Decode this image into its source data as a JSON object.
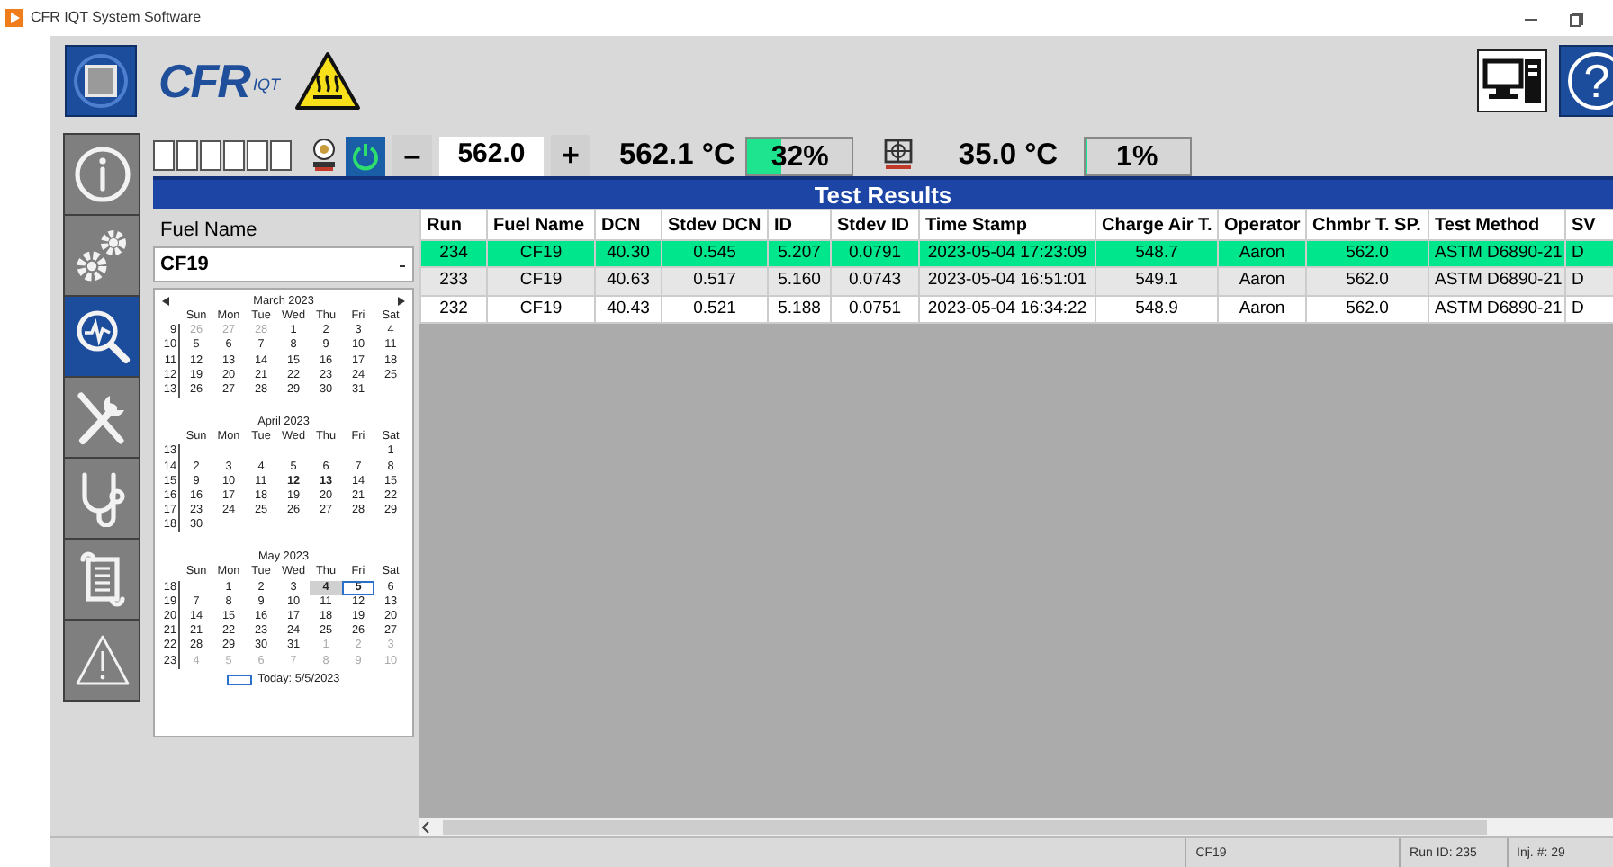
{
  "window": {
    "title": "CFR IQT System Software"
  },
  "header": {
    "logo": "CFR",
    "logo_sub": "IQT",
    "help": "?"
  },
  "sidebar": {
    "items": [
      {
        "kind": "info",
        "selected": false
      },
      {
        "kind": "settings",
        "selected": false
      },
      {
        "kind": "monitor",
        "selected": true
      },
      {
        "kind": "tools",
        "selected": false
      },
      {
        "kind": "diagnostics",
        "selected": false
      },
      {
        "kind": "log",
        "selected": false
      },
      {
        "kind": "alarms",
        "selected": false
      }
    ]
  },
  "toolbar": {
    "indicators": [
      {
        "on": false
      },
      {
        "on": false
      },
      {
        "on": false
      },
      {
        "on": false
      },
      {
        "on": false
      },
      {
        "on": false
      }
    ],
    "heater_power": {
      "on": true
    },
    "decrement": "–",
    "setpoint": "562.0",
    "increment": "+",
    "temperature": "562.1 °C",
    "heater_output": {
      "level": 0.32,
      "reading": "32%"
    },
    "chamber_temperature": "35.0 °C",
    "chamber_output": {
      "level": 0.01,
      "reading": "1%"
    }
  },
  "panel_title": "Test Results",
  "fuel": {
    "label": "Fuel Name",
    "value": "CF19"
  },
  "calendar": {
    "months": [
      {
        "title": "March 2023",
        "day_names": [
          "Sun",
          "Mon",
          "Tue",
          "Wed",
          "Thu",
          "Fri",
          "Sat"
        ],
        "weeks": [
          {
            "week": "9",
            "days": [
              {
                "text": "26",
                "kind": "other"
              },
              {
                "text": "27",
                "kind": "other"
              },
              {
                "text": "28",
                "kind": "other"
              },
              {
                "text": "1",
                "kind": "day"
              },
              {
                "text": "2",
                "kind": "day"
              },
              {
                "text": "3",
                "kind": "day"
              },
              {
                "text": "4",
                "kind": "day"
              }
            ]
          },
          {
            "week": "10",
            "days": [
              {
                "text": "5",
                "kind": "day"
              },
              {
                "text": "6",
                "kind": "day"
              },
              {
                "text": "7",
                "kind": "day"
              },
              {
                "text": "8",
                "kind": "day"
              },
              {
                "text": "9",
                "kind": "day"
              },
              {
                "text": "10",
                "kind": "day"
              },
              {
                "text": "11",
                "kind": "day"
              }
            ]
          },
          {
            "week": "11",
            "days": [
              {
                "text": "12",
                "kind": "day"
              },
              {
                "text": "13",
                "kind": "day"
              },
              {
                "text": "14",
                "kind": "day"
              },
              {
                "text": "15",
                "kind": "day"
              },
              {
                "text": "16",
                "kind": "day"
              },
              {
                "text": "17",
                "kind": "day"
              },
              {
                "text": "18",
                "kind": "day"
              }
            ]
          },
          {
            "week": "12",
            "days": [
              {
                "text": "19",
                "kind": "day"
              },
              {
                "text": "20",
                "kind": "day"
              },
              {
                "text": "21",
                "kind": "day"
              },
              {
                "text": "22",
                "kind": "day"
              },
              {
                "text": "23",
                "kind": "day"
              },
              {
                "text": "24",
                "kind": "day"
              },
              {
                "text": "25",
                "kind": "day"
              }
            ]
          },
          {
            "week": "13",
            "days": [
              {
                "text": "26",
                "kind": "day"
              },
              {
                "text": "27",
                "kind": "day"
              },
              {
                "text": "28",
                "kind": "day"
              },
              {
                "text": "29",
                "kind": "day"
              },
              {
                "text": "30",
                "kind": "day"
              },
              {
                "text": "31",
                "kind": "day"
              }
            ]
          }
        ]
      },
      {
        "title": "April 2023",
        "day_names": [
          "Sun",
          "Mon",
          "Tue",
          "Wed",
          "Thu",
          "Fri",
          "Sat"
        ],
        "weeks": [
          {
            "week": "13",
            "days": [
              {
                "kind": "blank"
              },
              {
                "kind": "blank"
              },
              {
                "kind": "blank"
              },
              {
                "kind": "blank"
              },
              {
                "kind": "blank"
              },
              {
                "kind": "blank"
              },
              {
                "text": "1",
                "kind": "day"
              }
            ]
          },
          {
            "week": "14",
            "days": [
              {
                "text": "2",
                "kind": "day"
              },
              {
                "text": "3",
                "kind": "day"
              },
              {
                "text": "4",
                "kind": "day"
              },
              {
                "text": "5",
                "kind": "day"
              },
              {
                "text": "6",
                "kind": "day"
              },
              {
                "text": "7",
                "kind": "day"
              },
              {
                "text": "8",
                "kind": "day"
              }
            ]
          },
          {
            "week": "15",
            "days": [
              {
                "text": "9",
                "kind": "day"
              },
              {
                "text": "10",
                "kind": "day"
              },
              {
                "text": "11",
                "kind": "day"
              },
              {
                "text": "12",
                "kind": "bold"
              },
              {
                "text": "13",
                "kind": "bold"
              },
              {
                "text": "14",
                "kind": "day"
              },
              {
                "text": "15",
                "kind": "day"
              }
            ]
          },
          {
            "week": "16",
            "days": [
              {
                "text": "16",
                "kind": "day"
              },
              {
                "text": "17",
                "kind": "day"
              },
              {
                "text": "18",
                "kind": "day"
              },
              {
                "text": "19",
                "kind": "day"
              },
              {
                "text": "20",
                "kind": "day"
              },
              {
                "text": "21",
                "kind": "day"
              },
              {
                "text": "22",
                "kind": "day"
              }
            ]
          },
          {
            "week": "17",
            "days": [
              {
                "text": "23",
                "kind": "day"
              },
              {
                "text": "24",
                "kind": "day"
              },
              {
                "text": "25",
                "kind": "day"
              },
              {
                "text": "26",
                "kind": "day"
              },
              {
                "text": "27",
                "kind": "day"
              },
              {
                "text": "28",
                "kind": "day"
              },
              {
                "text": "29",
                "kind": "day"
              }
            ]
          },
          {
            "week": "18",
            "days": [
              {
                "text": "30",
                "kind": "day"
              }
            ]
          }
        ]
      },
      {
        "title": "May 2023",
        "day_names": [
          "Sun",
          "Mon",
          "Tue",
          "Wed",
          "Thu",
          "Fri",
          "Sat"
        ],
        "weeks": [
          {
            "week": "18",
            "days": [
              {
                "kind": "blank"
              },
              {
                "text": "1",
                "kind": "day"
              },
              {
                "text": "2",
                "kind": "day"
              },
              {
                "text": "3",
                "kind": "day"
              },
              {
                "text": "4",
                "kind": "selected"
              },
              {
                "text": "5",
                "kind": "today"
              },
              {
                "text": "6",
                "kind": "day"
              }
            ]
          },
          {
            "week": "19",
            "days": [
              {
                "text": "7",
                "kind": "day"
              },
              {
                "text": "8",
                "kind": "day"
              },
              {
                "text": "9",
                "kind": "day"
              },
              {
                "text": "10",
                "kind": "day"
              },
              {
                "text": "11",
                "kind": "day"
              },
              {
                "text": "12",
                "kind": "day"
              },
              {
                "text": "13",
                "kind": "day"
              }
            ]
          },
          {
            "week": "20",
            "days": [
              {
                "text": "14",
                "kind": "day"
              },
              {
                "text": "15",
                "kind": "day"
              },
              {
                "text": "16",
                "kind": "day"
              },
              {
                "text": "17",
                "kind": "day"
              },
              {
                "text": "18",
                "kind": "day"
              },
              {
                "text": "19",
                "kind": "day"
              },
              {
                "text": "20",
                "kind": "day"
              }
            ]
          },
          {
            "week": "21",
            "days": [
              {
                "text": "21",
                "kind": "day"
              },
              {
                "text": "22",
                "kind": "day"
              },
              {
                "text": "23",
                "kind": "day"
              },
              {
                "text": "24",
                "kind": "day"
              },
              {
                "text": "25",
                "kind": "day"
              },
              {
                "text": "26",
                "kind": "day"
              },
              {
                "text": "27",
                "kind": "day"
              }
            ]
          },
          {
            "week": "22",
            "days": [
              {
                "text": "28",
                "kind": "day"
              },
              {
                "text": "29",
                "kind": "day"
              },
              {
                "text": "30",
                "kind": "day"
              },
              {
                "text": "31",
                "kind": "day"
              },
              {
                "text": "1",
                "kind": "other"
              },
              {
                "text": "2",
                "kind": "other"
              },
              {
                "text": "3",
                "kind": "other"
              }
            ]
          },
          {
            "week": "23",
            "days": [
              {
                "text": "4",
                "kind": "other"
              },
              {
                "text": "5",
                "kind": "other"
              },
              {
                "text": "6",
                "kind": "other"
              },
              {
                "text": "7",
                "kind": "other"
              },
              {
                "text": "8",
                "kind": "other"
              },
              {
                "text": "9",
                "kind": "other"
              },
              {
                "text": "10",
                "kind": "other"
              }
            ]
          }
        ]
      }
    ],
    "today": "Today: 5/5/2023"
  },
  "table": {
    "columns": [
      "Run",
      "Fuel Name",
      "DCN",
      "Stdev DCN",
      "ID",
      "Stdev ID",
      "Time Stamp",
      "Charge Air T.",
      "Operator",
      "Chmbr T. SP.",
      "Test Method",
      "SV"
    ],
    "rows": [
      {
        "selected": true,
        "cells": [
          "234",
          "CF19",
          "40.30",
          "0.545",
          "5.207",
          "0.0791",
          "2023-05-04 17:23:09",
          "548.7",
          "Aaron",
          "562.0",
          "ASTM D6890-21",
          "D"
        ]
      },
      {
        "selected": false,
        "cells": [
          "233",
          "CF19",
          "40.63",
          "0.517",
          "5.160",
          "0.0743",
          "2023-05-04 16:51:01",
          "549.1",
          "Aaron",
          "562.0",
          "ASTM D6890-21",
          "D"
        ]
      },
      {
        "selected": false,
        "cells": [
          "232",
          "CF19",
          "40.43",
          "0.521",
          "5.188",
          "0.0751",
          "2023-05-04 16:34:22",
          "548.9",
          "Aaron",
          "562.0",
          "ASTM D6890-21",
          "D"
        ]
      }
    ]
  },
  "status_bar": [
    "CF19",
    "Run ID: 235",
    "Inj. #: 29"
  ]
}
